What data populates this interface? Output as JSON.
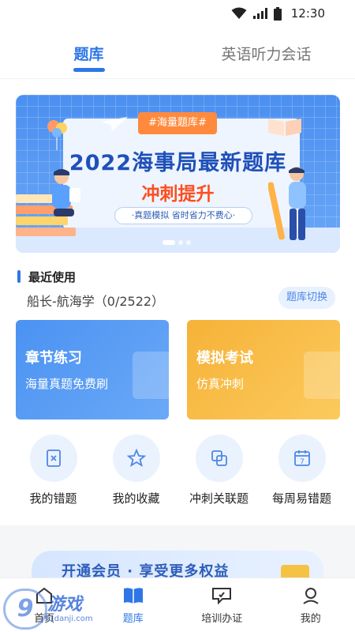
{
  "status_bar": {
    "time": "12:30"
  },
  "top_tabs": [
    {
      "label": "题库",
      "active": true
    },
    {
      "label": "英语听力会话",
      "active": false
    }
  ],
  "banner": {
    "tag": "#海量题库#",
    "headline": "2022海事局最新题库",
    "sub": "冲刺提升",
    "pill": "·真题模拟 省时省力不费心·",
    "slides": 3,
    "active_slide": 1
  },
  "recent": {
    "title": "最近使用",
    "subject": "船长-航海学（0/2522）",
    "switch_label": "题库切换"
  },
  "cards": [
    {
      "title": "章节练习",
      "subtitle": "海量真题免费刷",
      "color": "#4b92f2"
    },
    {
      "title": "模拟考试",
      "subtitle": "仿真冲刺",
      "color": "#f6b238"
    }
  ],
  "quick_entries": [
    {
      "label": "我的错题",
      "icon": "wrong-questions-icon"
    },
    {
      "label": "我的收藏",
      "icon": "star-icon"
    },
    {
      "label": "冲刺关联题",
      "icon": "linked-questions-icon"
    },
    {
      "label": "每周易错题",
      "icon": "calendar-icon",
      "day": "7"
    }
  ],
  "promo": {
    "text": "开通会员 · 享受更多权益"
  },
  "bottom_nav": [
    {
      "label": "首页",
      "icon": "home-icon",
      "active": false
    },
    {
      "label": "题库",
      "icon": "book-icon",
      "active": true
    },
    {
      "label": "培训办证",
      "icon": "certificate-icon",
      "active": false
    },
    {
      "label": "我的",
      "icon": "profile-icon",
      "active": false
    }
  ],
  "watermark": {
    "text": "游戏",
    "domain": "91danji.com",
    "number": "9"
  },
  "colors": {
    "primary": "#2e76e6",
    "orange": "#f6b238",
    "headline": "#1f50b8",
    "accent_red": "#ff4d1f"
  }
}
